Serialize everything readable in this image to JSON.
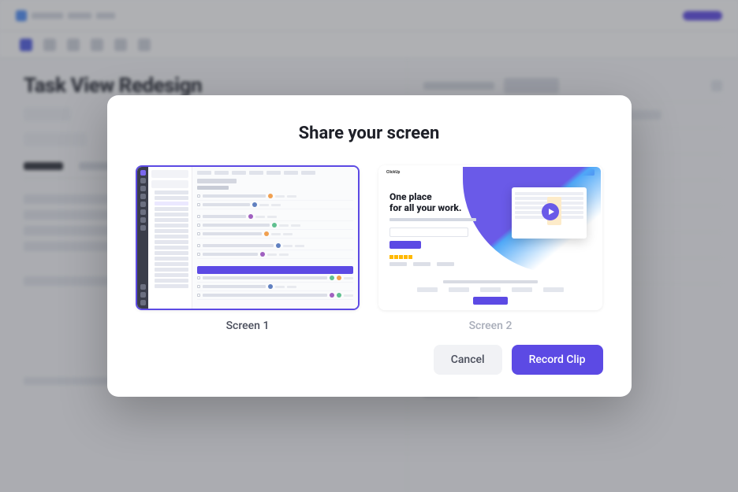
{
  "background": {
    "page_title": "Task View Redesign"
  },
  "modal": {
    "title": "Share your screen",
    "screens": [
      {
        "label": "Screen 1",
        "selected": true
      },
      {
        "label": "Screen 2",
        "selected": false
      }
    ],
    "thumb2": {
      "heading_line1": "One place",
      "heading_line2": "for all your work.",
      "logo": "ClickUp"
    },
    "cancel_label": "Cancel",
    "record_label": "Record Clip"
  }
}
